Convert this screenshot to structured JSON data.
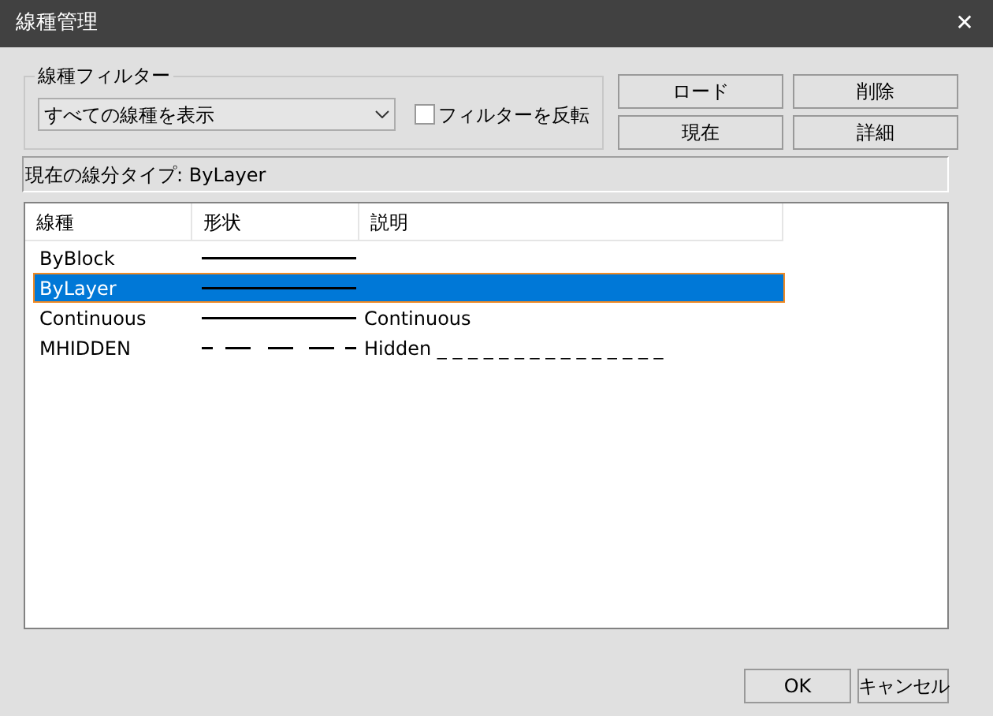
{
  "window": {
    "title": "線種管理",
    "close": "✕"
  },
  "filter": {
    "legend": "線種フィルター",
    "dropdown": "すべての線種を表示",
    "invert": {
      "label": "フィルターを反転",
      "checked": false
    }
  },
  "buttons": [
    "ロード",
    "削除",
    "現在",
    "詳細"
  ],
  "current": "現在の線分タイプ: ByLayer",
  "table": {
    "columns": [
      "線種",
      "形状",
      "説明"
    ],
    "rows": [
      {
        "name": "ByBlock",
        "kind": "solid",
        "selected": false
      },
      {
        "name": "ByLayer",
        "kind": "solid",
        "selected": true
      },
      {
        "name": "Continuous",
        "kind": "solid",
        "description": "Continuous",
        "selected": false
      },
      {
        "name": "MHIDDEN",
        "kind": "dashed",
        "description": "Hidden _ _ _ _ _ _ _ _ _ _ _ _ _ _ _",
        "selected": false
      }
    ]
  },
  "footer": [
    "OK",
    "キャンセル"
  ]
}
